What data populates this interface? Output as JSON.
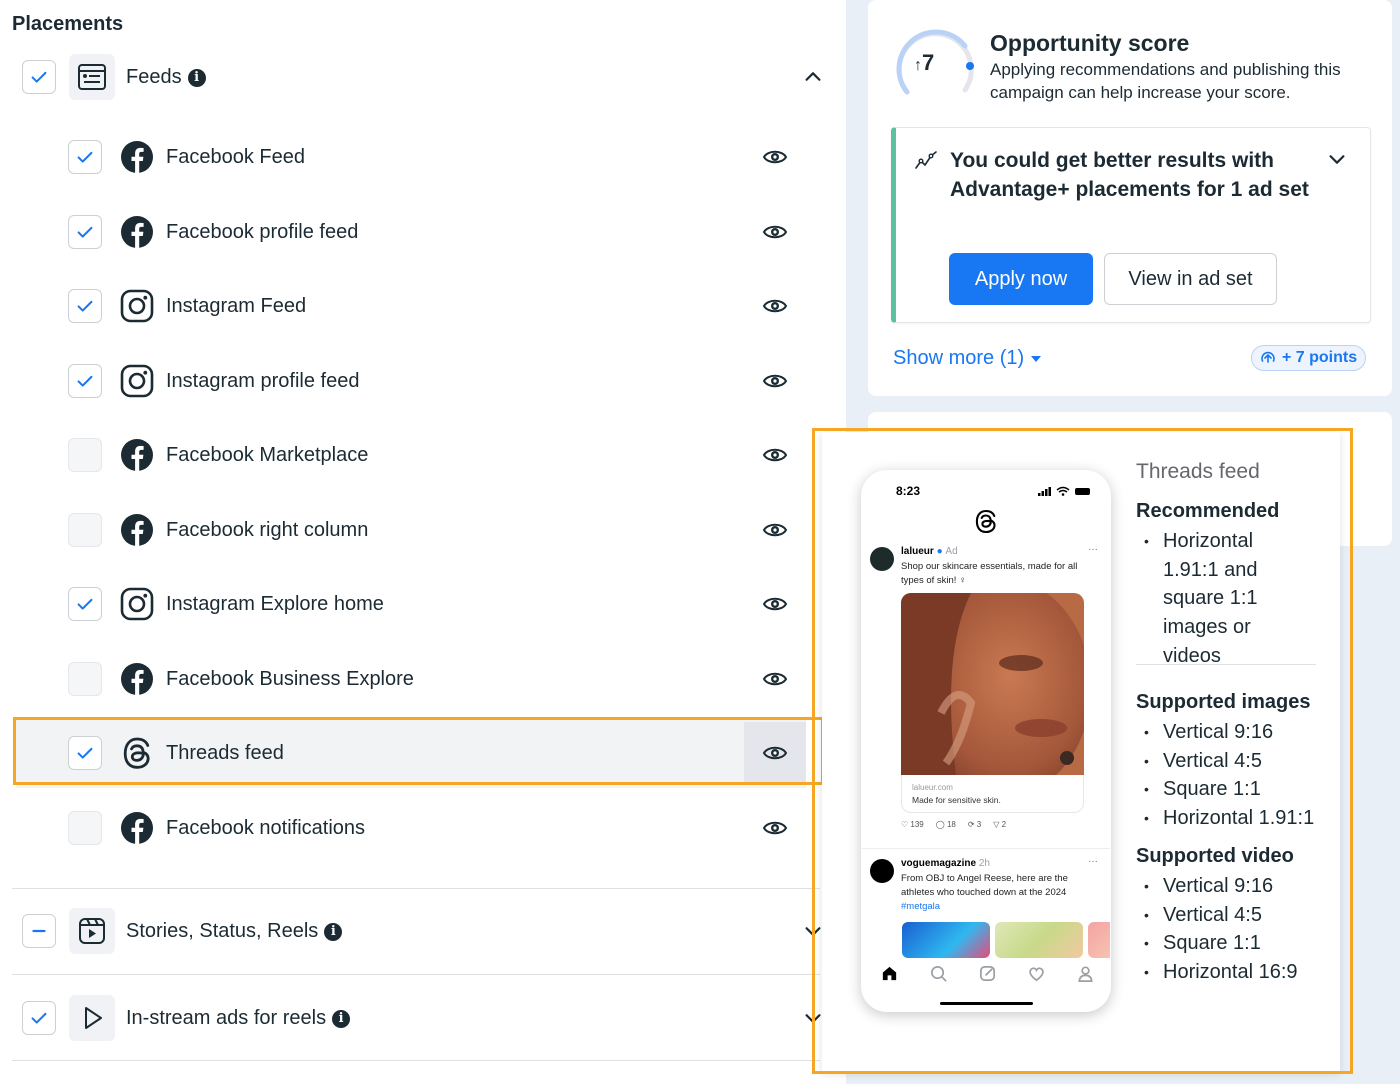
{
  "placements": {
    "title": "Placements",
    "groups": [
      {
        "label": "Feeds",
        "state": "checked",
        "expanded": true
      },
      {
        "label": "Stories, Status, Reels",
        "state": "indeterminate",
        "expanded": false
      },
      {
        "label": "In-stream ads for reels",
        "state": "checked",
        "expanded": false
      }
    ],
    "feeds_items": [
      {
        "label": "Facebook Feed",
        "checked": true,
        "platform": "facebook"
      },
      {
        "label": "Facebook profile feed",
        "checked": true,
        "platform": "facebook"
      },
      {
        "label": "Instagram Feed",
        "checked": true,
        "platform": "instagram"
      },
      {
        "label": "Instagram profile feed",
        "checked": true,
        "platform": "instagram"
      },
      {
        "label": "Facebook Marketplace",
        "checked": false,
        "platform": "facebook"
      },
      {
        "label": "Facebook right column",
        "checked": false,
        "platform": "facebook"
      },
      {
        "label": "Instagram Explore home",
        "checked": true,
        "platform": "instagram"
      },
      {
        "label": "Facebook Business Explore",
        "checked": false,
        "platform": "facebook"
      },
      {
        "label": "Threads feed",
        "checked": true,
        "platform": "threads",
        "selected": true
      },
      {
        "label": "Facebook notifications",
        "checked": false,
        "platform": "facebook"
      }
    ]
  },
  "opportunity": {
    "score": "7",
    "title": "Opportunity score",
    "description": "Applying recommendations and publishing this campaign can help increase your score.",
    "recommendation": "You could get better results with Advantage+ placements for 1 ad set",
    "apply_label": "Apply now",
    "view_label": "View in ad set",
    "show_more": "Show more (1)",
    "points": "+ 7 points"
  },
  "preview": {
    "title": "Threads feed",
    "recommended_heading": "Recommended",
    "recommended": [
      "Horizontal 1.91:1 and square 1:1 images or videos"
    ],
    "images_heading": "Supported images",
    "images": [
      "Vertical 9:16",
      "Vertical 4:5",
      "Square 1:1",
      "Horizontal 1.91:1"
    ],
    "video_heading": "Supported video",
    "video": [
      "Vertical 9:16",
      "Vertical 4:5",
      "Square 1:1",
      "Horizontal 16:9"
    ],
    "phone": {
      "time": "8:23",
      "post1": {
        "user": "lalueur",
        "meta": "Ad",
        "text": "Shop our skincare essentials, made for all types of skin! ♀",
        "source": "lalueur.com",
        "caption": "Made for sensitive skin.",
        "likes": "139",
        "comments": "18",
        "reposts": "3",
        "shares": "2"
      },
      "post2": {
        "user": "voguemagazine",
        "meta": "2h",
        "text": "From OBJ to Angel Reese, here are the athletes who touched down at the 2024",
        "tag": "#metgala"
      }
    }
  },
  "colors": {
    "accent": "#1877f2",
    "highlight": "#f5a623",
    "recommendation_bar": "#5fc0a1",
    "right_bg": "#e9eff7"
  }
}
